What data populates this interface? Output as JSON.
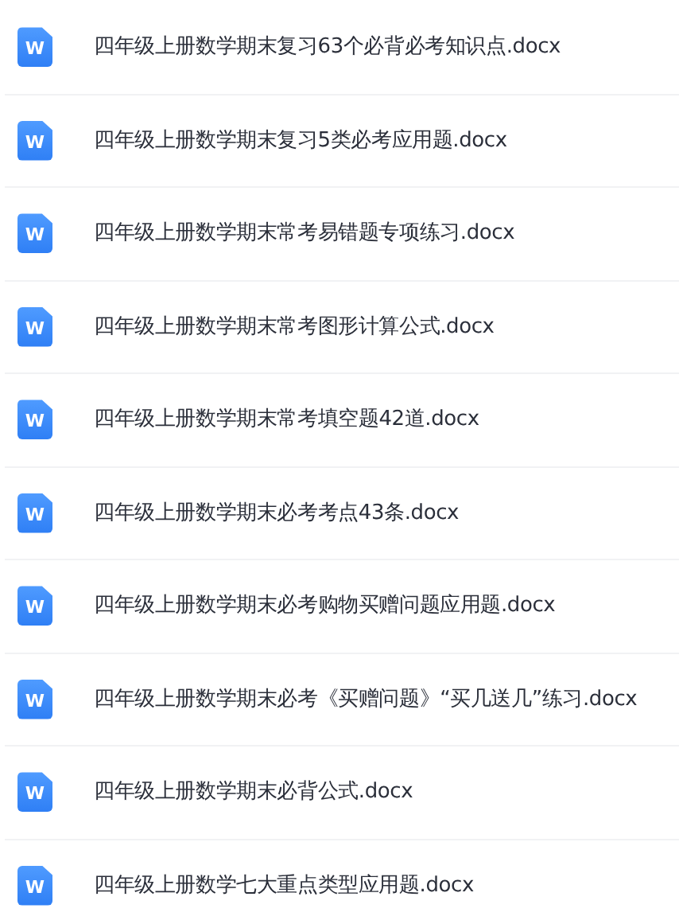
{
  "files": [
    {
      "icon_letter": "W",
      "name": "四年级上册数学期末复习63个必背必考知识点.docx"
    },
    {
      "icon_letter": "W",
      "name": "四年级上册数学期末复习5类必考应用题.docx"
    },
    {
      "icon_letter": "W",
      "name": "四年级上册数学期末常考易错题专项练习.docx"
    },
    {
      "icon_letter": "W",
      "name": "四年级上册数学期末常考图形计算公式.docx"
    },
    {
      "icon_letter": "W",
      "name": "四年级上册数学期末常考填空题42道.docx"
    },
    {
      "icon_letter": "W",
      "name": "四年级上册数学期末必考考点43条.docx"
    },
    {
      "icon_letter": "W",
      "name": "四年级上册数学期末必考购物买赠问题应用题.docx"
    },
    {
      "icon_letter": "W",
      "name": "四年级上册数学期末必考《买赠问题》“买几送几”练习.docx"
    },
    {
      "icon_letter": "W",
      "name": "四年级上册数学期末必背公式.docx"
    },
    {
      "icon_letter": "W",
      "name": "四年级上册数学七大重点类型应用题.docx"
    }
  ]
}
